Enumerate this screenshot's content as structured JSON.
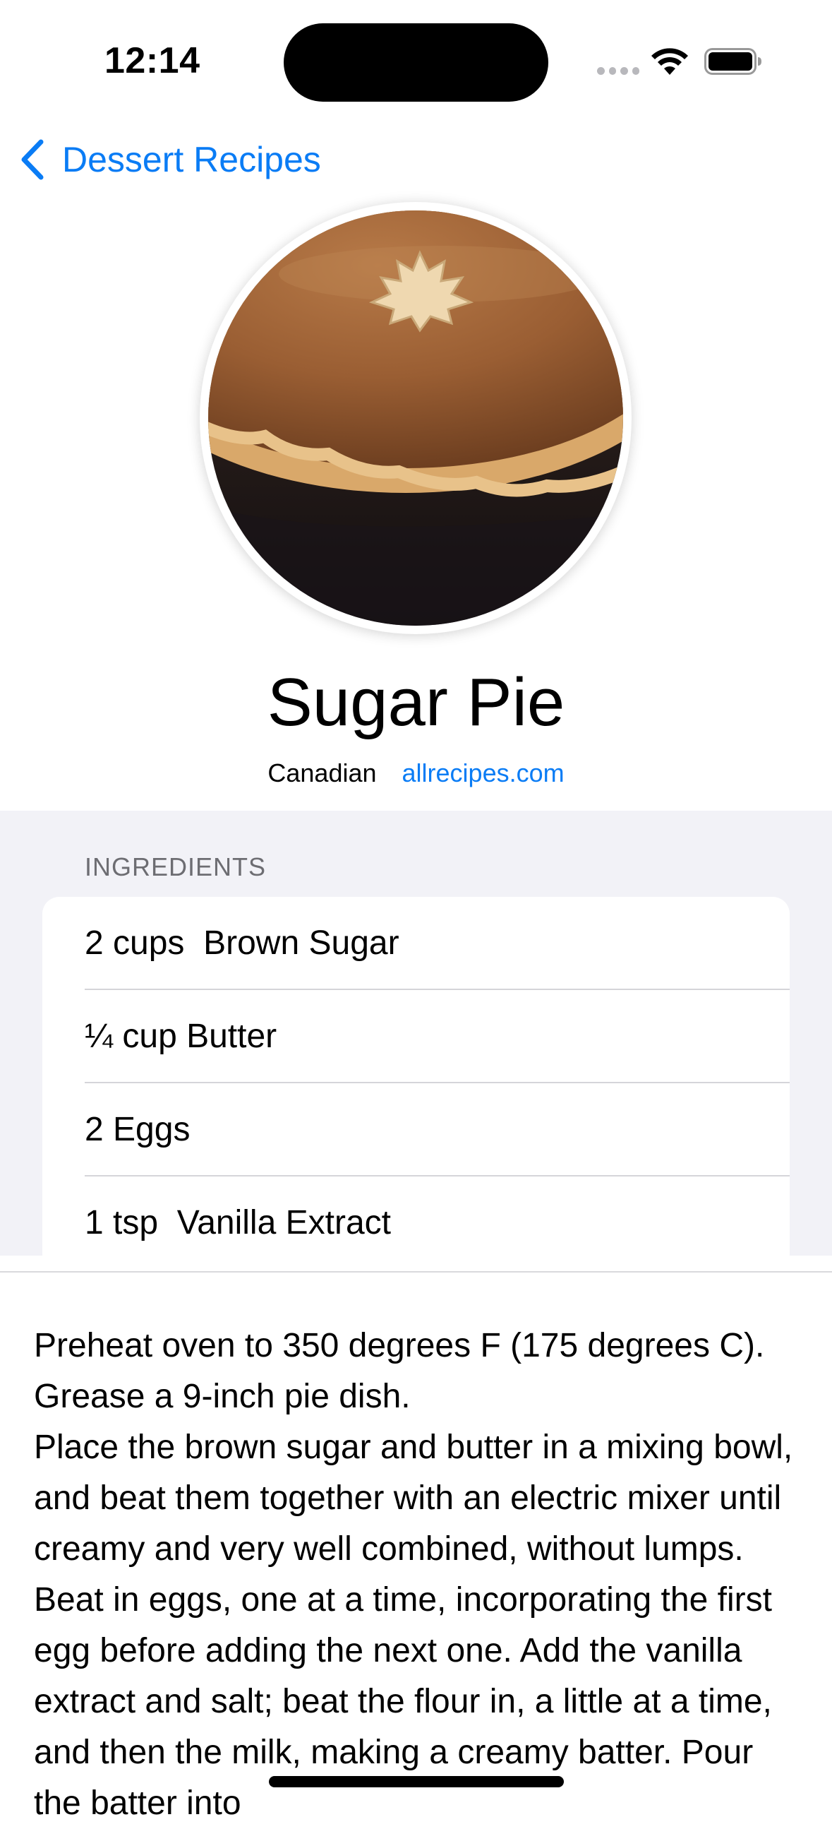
{
  "status": {
    "time": "12:14"
  },
  "nav": {
    "back_label": "Dessert Recipes"
  },
  "recipe": {
    "title": "Sugar Pie",
    "cuisine": "Canadian",
    "source": "allrecipes.com",
    "ingredients_header": "INGREDIENTS",
    "ingredients": [
      {
        "text": "2 cups  Brown Sugar"
      },
      {
        "text": "¼ cup Butter"
      },
      {
        "text": "2 Eggs"
      },
      {
        "text": "1 tsp  Vanilla Extract"
      }
    ],
    "instructions": [
      "Preheat oven to 350 degrees F (175 degrees C). Grease a 9-inch pie dish.",
      "Place the brown sugar and butter in a mixing bowl, and beat them together with an electric mixer until creamy and very well combined, without lumps. Beat in eggs, one at a time, incorporating the first egg before adding the next one. Add the vanilla extract and salt; beat the flour in, a little at a time, and then the milk, making a creamy batter. Pour the batter into"
    ]
  },
  "colors": {
    "accent": "#0a7cf5",
    "grouped_bg": "#f2f2f7",
    "secondary_text": "#6d6d72"
  },
  "icons": [
    "chevron-left-icon",
    "wifi-icon",
    "battery-icon",
    "cellular-signal-icon"
  ]
}
